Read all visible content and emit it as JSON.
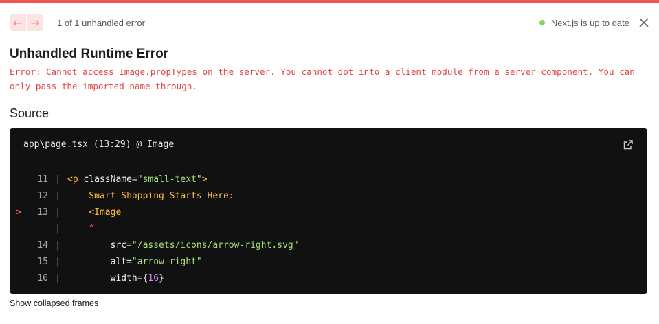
{
  "header": {
    "prev_icon": "arrow-left-icon",
    "next_icon": "arrow-right-icon",
    "error_count": "1 of 1 unhandled error",
    "status_text": "Next.js is up to date",
    "status_color": "#7ed957",
    "close_icon": "close-icon"
  },
  "error": {
    "title": "Unhandled Runtime Error",
    "message": "Error: Cannot access Image.propTypes on the server. You cannot dot into a client module from a server component. You can only pass the imported name through."
  },
  "source": {
    "heading": "Source",
    "file": "app\\page.tsx (13:29) @ Image",
    "open_icon": "external-link-icon",
    "lines": [
      {
        "num": "11",
        "marker": "",
        "parts": [
          {
            "t": "<p ",
            "c": "c-tag"
          },
          {
            "t": "className",
            "c": "c-attr"
          },
          {
            "t": "=",
            "c": "c-brace"
          },
          {
            "t": "\"small-text\"",
            "c": "c-str"
          },
          {
            "t": ">",
            "c": "c-tag"
          }
        ]
      },
      {
        "num": "12",
        "marker": "",
        "parts": [
          {
            "t": "    Smart Shopping Starts Here:",
            "c": "c-tag"
          }
        ]
      },
      {
        "num": "13",
        "marker": ">",
        "parts": [
          {
            "t": "    <Image",
            "c": "c-tag"
          }
        ]
      },
      {
        "num": "",
        "marker": "",
        "parts": [
          {
            "t": "    ^",
            "c": "c-caret"
          }
        ]
      },
      {
        "num": "14",
        "marker": "",
        "parts": [
          {
            "t": "        src",
            "c": "c-attr"
          },
          {
            "t": "=",
            "c": "c-brace"
          },
          {
            "t": "\"/assets/icons/arrow-right.svg\"",
            "c": "c-str"
          }
        ]
      },
      {
        "num": "15",
        "marker": "",
        "parts": [
          {
            "t": "        alt",
            "c": "c-attr"
          },
          {
            "t": "=",
            "c": "c-brace"
          },
          {
            "t": "\"arrow-right\"",
            "c": "c-str"
          }
        ]
      },
      {
        "num": "16",
        "marker": "",
        "parts": [
          {
            "t": "        width",
            "c": "c-attr"
          },
          {
            "t": "={",
            "c": "c-brace"
          },
          {
            "t": "16",
            "c": "c-num"
          },
          {
            "t": "}",
            "c": "c-brace"
          }
        ]
      }
    ]
  },
  "footer": {
    "collapsed_label": "Show collapsed frames"
  },
  "colors": {
    "accent_red": "#ee5555",
    "code_bg": "#111111"
  }
}
